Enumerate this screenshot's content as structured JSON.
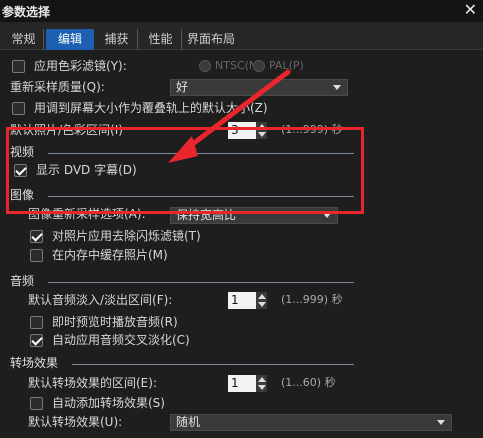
{
  "window": {
    "title": "参数选择",
    "close_glyph": "✕"
  },
  "tabs": [
    {
      "label": "常规"
    },
    {
      "label": "编辑"
    },
    {
      "label": "捕获"
    },
    {
      "label": "性能"
    },
    {
      "label": "界面布局"
    }
  ],
  "edit": {
    "color_filter": {
      "label": "应用色彩滤镜(Y):",
      "checked": false,
      "ntsc": "NTSC(N)",
      "pal": "PAL(P)"
    },
    "resample_quality": {
      "label": "重新采样质量(Q):",
      "value": "好"
    },
    "fit_overlay": {
      "label": "用调到屏幕大小作为覆叠轨上的默认大小(Z)",
      "checked": false
    },
    "photo_interval": {
      "label": "默认照片/色彩区间(I)",
      "value": "3",
      "range": "(1...999) 秒"
    }
  },
  "video": {
    "title": "视频",
    "show_dvd": {
      "label": "显示 DVD 字幕(D)",
      "checked": true
    }
  },
  "image": {
    "title": "图像",
    "resample_option": {
      "label": "图像重新采样选项(A):",
      "value": "保持宽高比"
    },
    "deflicker": {
      "label": "对照片应用去除闪烁滤镜(T)",
      "checked": true
    },
    "cache": {
      "label": "在内存中缓存照片(M)",
      "checked": false
    }
  },
  "audio": {
    "title": "音频",
    "fade": {
      "label": "默认音频淡入/淡出区间(F):",
      "value": "1",
      "range": "(1...999) 秒"
    },
    "instant_preview": {
      "label": "即时预览时播放音频(R)",
      "checked": false
    },
    "crossfade": {
      "label": "自动应用音频交叉淡化(C)",
      "checked": true
    }
  },
  "transition": {
    "title": "转场效果",
    "duration": {
      "label": "默认转场效果的区间(E):",
      "value": "1",
      "range": "(1...60) 秒"
    },
    "auto_add": {
      "label": "自动添加转场效果(S)",
      "checked": false
    },
    "default_effect": {
      "label": "默认转场效果(U):",
      "value": "随机"
    }
  },
  "colors": {
    "accent": "#1d5fb0",
    "highlight": "#e8262c"
  }
}
